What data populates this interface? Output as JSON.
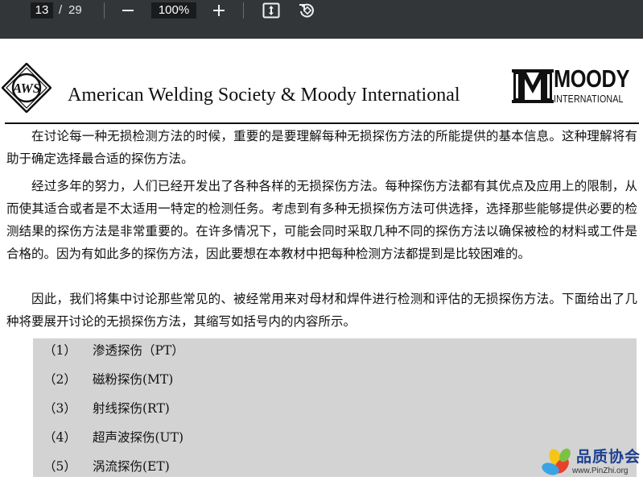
{
  "toolbar": {
    "page_current": "13",
    "page_separator": "/",
    "page_total": "29",
    "zoom": "100%",
    "icons": [
      "minus-icon",
      "plus-icon",
      "fit-page-icon",
      "rotate-icon"
    ],
    "background": "#323639"
  },
  "document": {
    "header": {
      "aws_logo_text": "AWS",
      "title": "American Welding Society & Moody International",
      "moody_logo_text": "MOODY",
      "moody_logo_subtext": "INTERNATIONAL"
    },
    "paragraphs": [
      "在讨论每一种无损检测方法的时候，重要的是要理解每种无损探伤方法的所能提供的基本信息。这种理解将有助于确定选择最合适的探伤方法。",
      "经过多年的努力，人们已经开发出了各种各样的无损探伤方法。每种探伤方法都有其优点及应用上的限制，从而使其适合或者是不太适用一特定的检测任务。考虑到有多种无损探伤方法可供选择，选择那些能够提供必要的检测结果的探伤方法是非常重要的。在许多情况下，可能会同时采取几种不同的探伤方法以确保被检的材料或工件是合格的。因为有如此多的探伤方法，因此要想在本教材中把每种检测方法都提到是比较困难的。",
      "因此，我们将集中讨论那些常见的、被经常用来对母材和焊件进行检测和评估的无损探伤方法。下面给出了几种将要展开讨论的无损探伤方法，其缩写如括号内的内容所示。"
    ],
    "methods": [
      {
        "number": "（1）",
        "label": "渗透探伤（PT）"
      },
      {
        "number": "（2）",
        "label": "磁粉探伤(MT)"
      },
      {
        "number": "（3）",
        "label": "射线探伤(RT)"
      },
      {
        "number": "（4）",
        "label": "超声波探伤(UT)"
      },
      {
        "number": "（5）",
        "label": "涡流探伤(ET)"
      }
    ],
    "list_background": "#d3d3d3"
  },
  "watermark": {
    "name": "品质协会",
    "url": "www.PinZhi.org"
  }
}
